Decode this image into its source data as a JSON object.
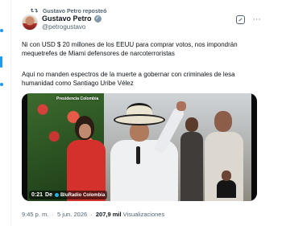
{
  "repost": {
    "label": "Gustavo Petro reposteó"
  },
  "author": {
    "name": "Gustavo Petro",
    "handle": "@petrogustavo"
  },
  "icons": {
    "repost": "repost-icon",
    "verified": "verified-badge-icon",
    "grok": "grok-icon",
    "more": "more-options-icon"
  },
  "tweet": {
    "paragraph1": "Ni con USD $ 20 millones de los  EEUU para comprar votos, nos impondrán mequetrefes de Miami defensores de narcoterroristas",
    "paragraph2": "Aquí no manden espectros de la muerte a gobernar con criminales de lesa humanidad como Santiago Uribe Vélez"
  },
  "video": {
    "duration": "0:21",
    "source_prefix": "De",
    "source_name": "BluRadio Colombia",
    "channel_logo": "Presidencia Colombia"
  },
  "meta": {
    "time": "9:45 p. m.",
    "date": "5 jun. 2026",
    "views": "207,9 mil",
    "views_label": "Visualizaciones",
    "separator": "·"
  },
  "colors": {
    "accent": "#1d9bf0",
    "text_primary": "#0f1419",
    "text_secondary": "#536471"
  }
}
